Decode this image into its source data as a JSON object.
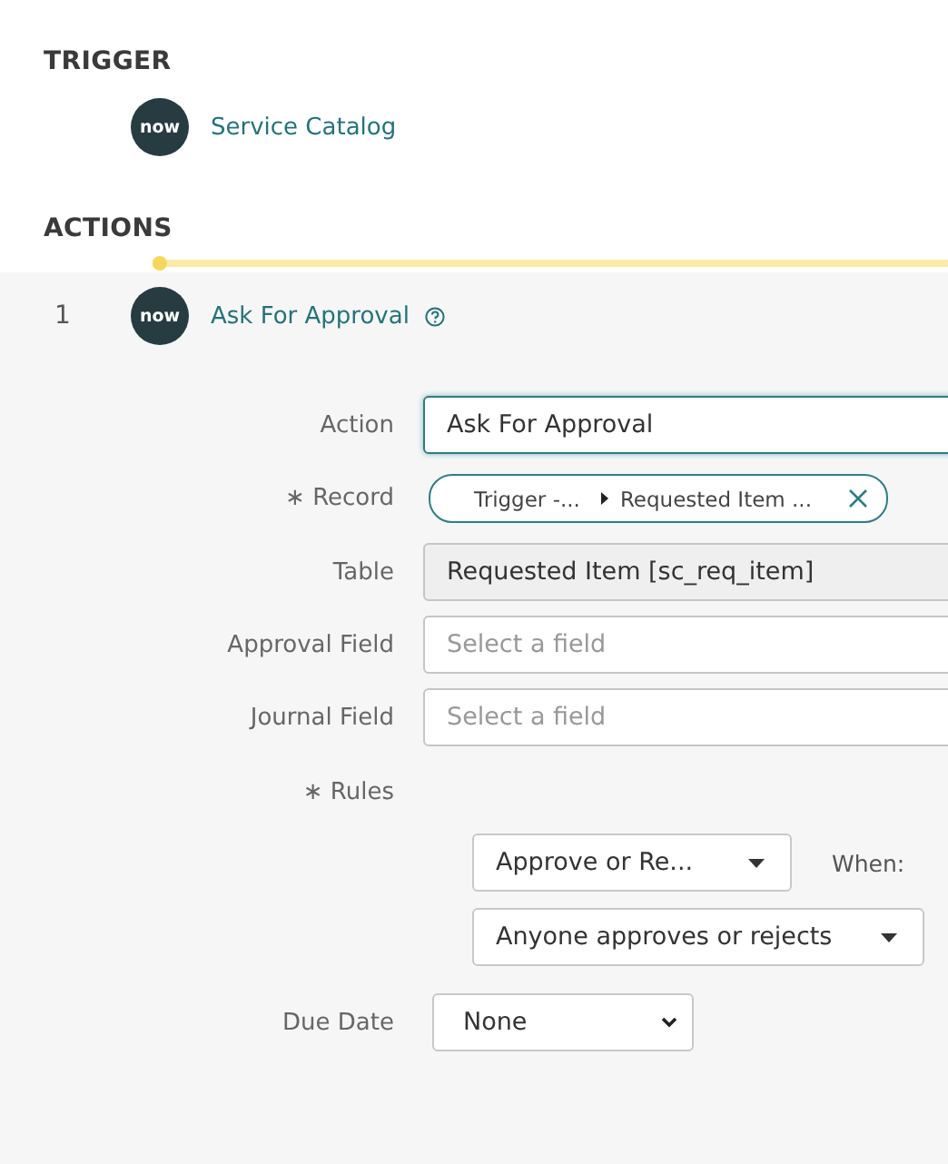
{
  "trigger": {
    "heading": "TRIGGER",
    "logo_text": "now",
    "name": "Service Catalog"
  },
  "actions": {
    "heading": "ACTIONS",
    "items": [
      {
        "number": "1",
        "logo_text": "now",
        "name": "Ask For Approval",
        "fields": [
          {
            "kind": "input",
            "label": "Action",
            "value": "Ask For Approval",
            "focused": true
          },
          {
            "kind": "pill",
            "label": "∗ Record",
            "tokens": [
              "Trigger -...",
              "Requested Item ..."
            ]
          },
          {
            "kind": "readonly",
            "label": "Table",
            "value": "Requested Item [sc_req_item]"
          },
          {
            "kind": "input",
            "label": "Approval Field",
            "placeholder": "Select a field",
            "focused": false
          },
          {
            "kind": "input",
            "label": "Journal Field",
            "placeholder": "Select a field",
            "focused": false
          }
        ],
        "rules": {
          "label": "∗ Rules",
          "rule_select": "Approve or Re...",
          "when_label": "When:",
          "when_select": "Anyone approves or rejects"
        },
        "due_date": {
          "label": "Due Date",
          "value": "None"
        }
      }
    ]
  }
}
